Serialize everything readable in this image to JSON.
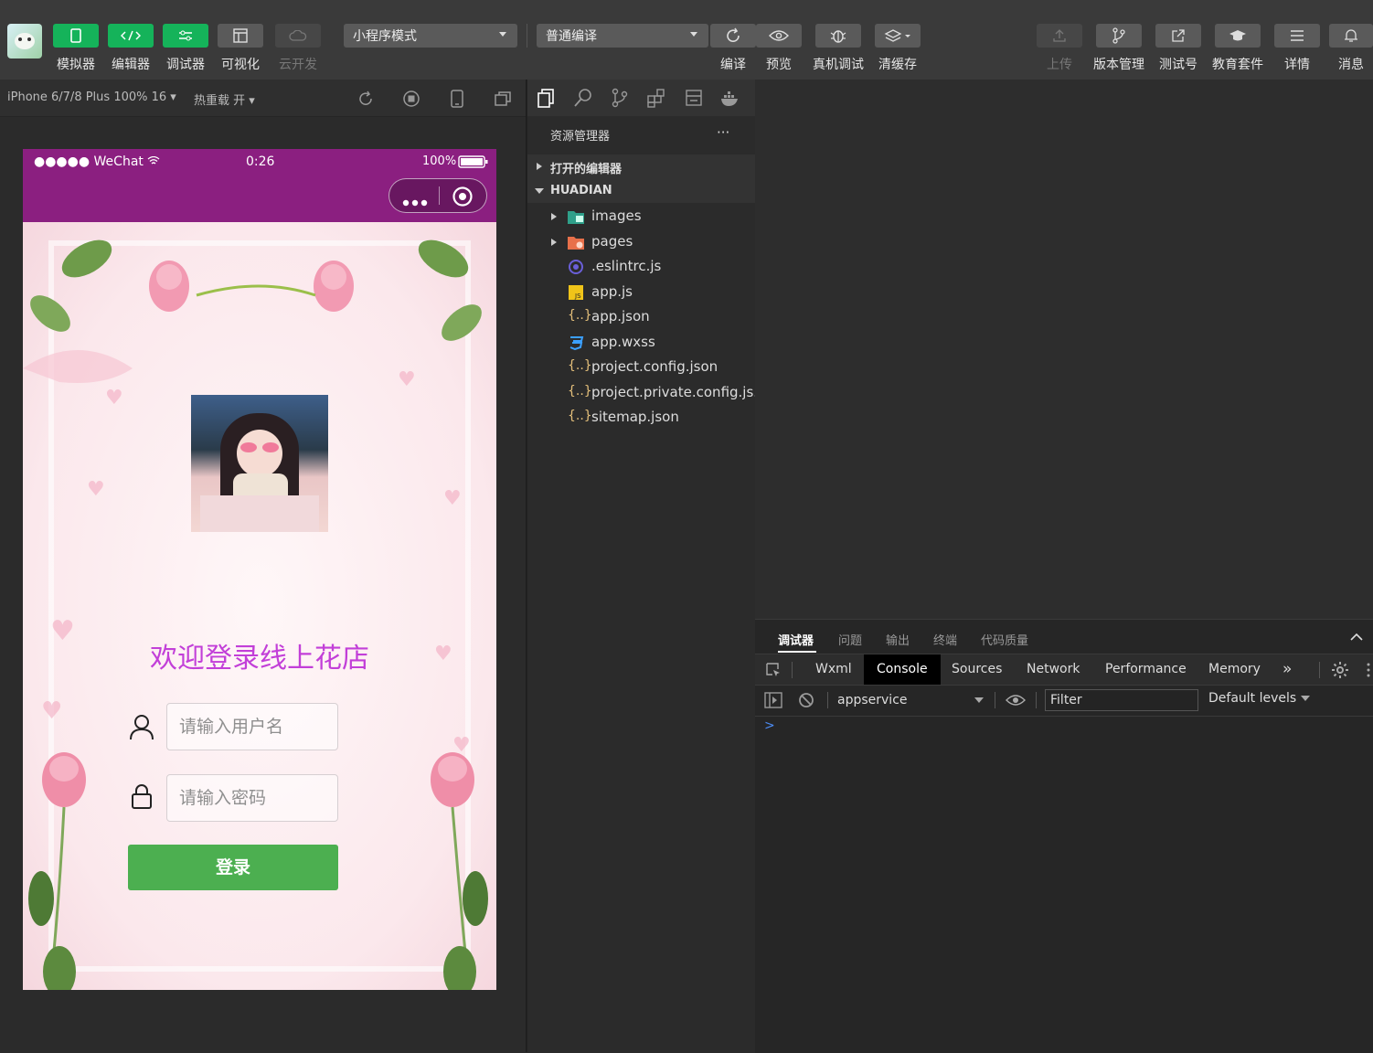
{
  "toolbar": {
    "left_buttons": [
      {
        "label": "模拟器",
        "icon": "phone-icon"
      },
      {
        "label": "编辑器",
        "icon": "code-icon"
      },
      {
        "label": "调试器",
        "icon": "sliders-icon"
      },
      {
        "label": "可视化",
        "icon": "layout-icon"
      },
      {
        "label": "云开发",
        "icon": "cloud-icon"
      }
    ],
    "mode_select": "小程序模式",
    "compile_select": "普通编译",
    "mid_buttons": [
      {
        "label": "编译",
        "icon": "refresh-icon"
      },
      {
        "label": "预览",
        "icon": "eye-icon"
      },
      {
        "label": "真机调试",
        "icon": "bug-icon"
      },
      {
        "label": "清缓存",
        "icon": "layers-icon"
      }
    ],
    "right_buttons": [
      {
        "label": "上传",
        "icon": "upload-icon"
      },
      {
        "label": "版本管理",
        "icon": "branch-icon"
      },
      {
        "label": "测试号",
        "icon": "external-link-icon"
      },
      {
        "label": "教育套件",
        "icon": "graduation-cap-icon"
      },
      {
        "label": "详情",
        "icon": "menu-icon"
      },
      {
        "label": "消息",
        "icon": "bell-icon"
      }
    ]
  },
  "simulator": {
    "device": "iPhone 6/7/8 Plus 100% 16",
    "hot_reload": "热重载 开",
    "status": {
      "carrier": "●●●●● WeChat",
      "time": "0:26",
      "battery": "100%"
    },
    "welcome": "欢迎登录线上花店",
    "username_placeholder": "请输入用户名",
    "password_placeholder": "请输入密码",
    "login_label": "登录"
  },
  "explorer": {
    "title": "资源管理器",
    "more": "···",
    "open_editors": "打开的编辑器",
    "project": "HUADIAN",
    "files": [
      {
        "name": "images",
        "type": "folder"
      },
      {
        "name": "pages",
        "type": "folder"
      },
      {
        "name": ".eslintrc.js",
        "type": "eslint"
      },
      {
        "name": "app.js",
        "type": "js"
      },
      {
        "name": "app.json",
        "type": "json"
      },
      {
        "name": "app.wxss",
        "type": "css"
      },
      {
        "name": "project.config.json",
        "type": "json"
      },
      {
        "name": "project.private.config.js...",
        "type": "json"
      },
      {
        "name": "sitemap.json",
        "type": "json"
      }
    ]
  },
  "devtools": {
    "tabs": [
      "调试器",
      "问题",
      "输出",
      "终端",
      "代码质量"
    ],
    "panel_tabs": [
      "Wxml",
      "Console",
      "Sources",
      "Network",
      "Performance",
      "Memory"
    ],
    "more": "»",
    "context": "appservice",
    "filter_placeholder": "Filter",
    "levels": "Default levels",
    "prompt": ">"
  }
}
